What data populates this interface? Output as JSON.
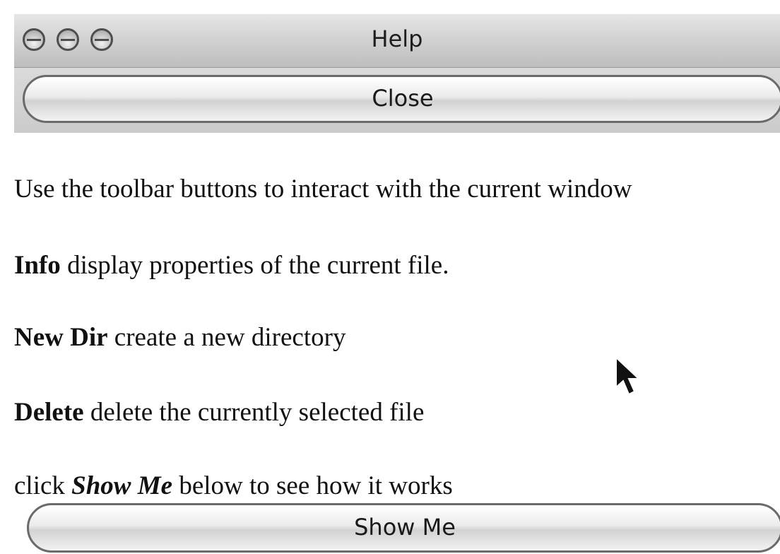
{
  "window": {
    "title": "Help"
  },
  "toolbar": {
    "close_label": "Close"
  },
  "content": {
    "intro": "Use the toolbar buttons to interact with the current window",
    "items": [
      {
        "term": "Info",
        "description": " display properties of the current file."
      },
      {
        "term": "New Dir",
        "description": " create a new directory"
      },
      {
        "term": "Delete",
        "description": " delete the currently selected file"
      }
    ],
    "hint": {
      "before": "click ",
      "emphasis": "Show Me",
      "after": " below to see how it works"
    }
  },
  "footer": {
    "show_me_label": "Show Me"
  },
  "icons": {
    "window_controls": [
      "close-icon",
      "minimize-icon",
      "zoom-icon"
    ],
    "pointer": "mouse-pointer-icon"
  },
  "colors": {
    "titlebar": "#cfcfcf",
    "button_border": "#6a6a6a",
    "text": "#111111"
  }
}
